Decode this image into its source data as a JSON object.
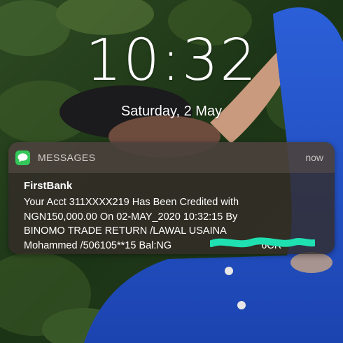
{
  "lockscreen": {
    "time": "10:32",
    "date": "Saturday, 2 May"
  },
  "notification": {
    "app_icon": "messages-icon",
    "app_name": "MESSAGES",
    "time_ago": "now",
    "sender": "FirstBank",
    "lines": [
      "Your Acct 311XXXX219 Has Been Credited with",
      "NGN150,000.00 On 02-MAY_2020 10:32:15 By",
      "BINOMO TRADE RETURN /LAWAL USAINA",
      "Mohammed /506105**15 Bal:NG",
      "6CR"
    ]
  },
  "colors": {
    "app_icon": "#34c759",
    "redaction_scribble": "#1fe0b0"
  }
}
